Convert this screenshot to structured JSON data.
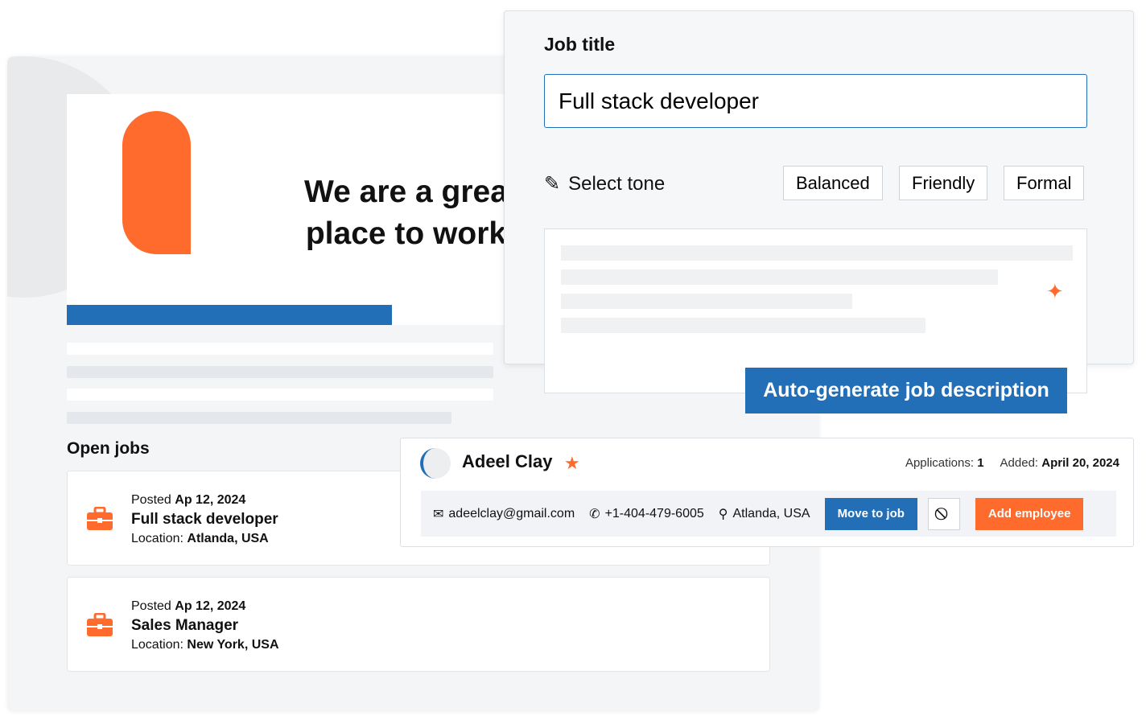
{
  "hero": {
    "headline_line1": "We are a grea",
    "headline_line2": "place to work"
  },
  "open_jobs": {
    "title": "Open jobs",
    "jobs": [
      {
        "posted_label": "Posted",
        "posted_date": "Ap 12, 2024",
        "title": "Full stack developer",
        "location_label": "Location:",
        "location": "Atlanda, USA"
      },
      {
        "posted_label": "Posted",
        "posted_date": "Ap 12, 2024",
        "title": "Sales Manager",
        "location_label": "Location:",
        "location": "New York, USA"
      }
    ]
  },
  "job_form": {
    "label": "Job title",
    "value": "Full stack developer",
    "tone_label": "Select tone",
    "tones": [
      "Balanced",
      "Friendly",
      "Formal"
    ],
    "generate_label": "Auto-generate job description"
  },
  "candidate": {
    "name": "Adeel Clay",
    "applications_label": "Applications:",
    "applications": "1",
    "added_label": "Added:",
    "added": "April 20, 2024",
    "email": "adeelclay@gmail.com",
    "phone": "+1-404-479-6005",
    "location": "Atlanda, USA",
    "move_label": "Move to job",
    "add_label": "Add employee"
  },
  "colors": {
    "accent": "#ff6b2c",
    "primary": "#226fb7"
  }
}
